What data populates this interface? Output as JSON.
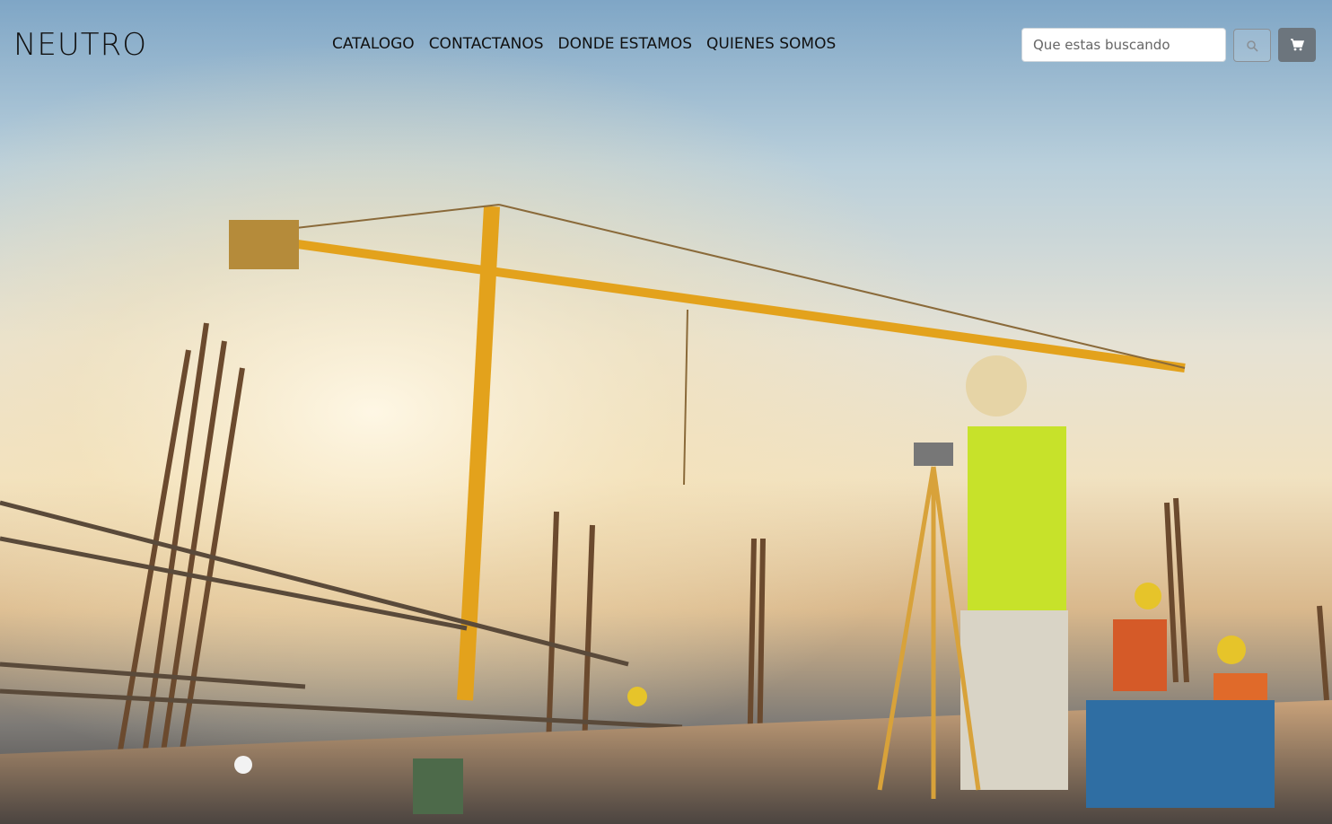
{
  "brand": {
    "logo_text": "NEUTRO"
  },
  "nav": {
    "items": [
      {
        "label": "CATALOGO"
      },
      {
        "label": "CONTACTANOS"
      },
      {
        "label": "DONDE ESTAMOS"
      },
      {
        "label": "QUIENES SOMOS"
      }
    ]
  },
  "search": {
    "placeholder": "Que estas buscando",
    "button_icon": "search-icon"
  },
  "cart": {
    "icon": "cart-icon",
    "button_color": "#6c757d"
  },
  "hero": {
    "image_subject": "construction site with crane and workers"
  }
}
